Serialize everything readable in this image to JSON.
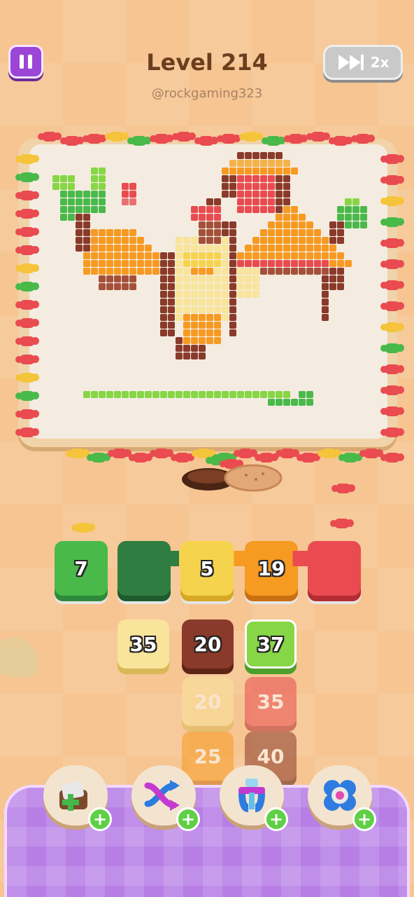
{
  "header": {
    "title": "Level 214",
    "handle": "@rockgaming323",
    "speed_label": "2x"
  },
  "colors": {
    "red": "#e94b50",
    "green": "#49b94a",
    "dark_green": "#2f7d40",
    "yellow": "#f5d34c",
    "orange": "#f79a22",
    "brown": "#8a3a2a",
    "cream": "#f8e49a",
    "lime": "#86d645"
  },
  "slots": [
    {
      "label": "7",
      "color": "green"
    },
    {
      "label": "",
      "color": "dark_green"
    },
    {
      "label": "5",
      "color": "yellow"
    },
    {
      "label": "19",
      "color": "orange"
    },
    {
      "label": "",
      "color": "red"
    }
  ],
  "tiles": [
    {
      "label": "35",
      "color": "cream",
      "state": "active"
    },
    {
      "label": "20",
      "color": "brown",
      "state": "active"
    },
    {
      "label": "37",
      "color": "lime",
      "state": "selected"
    },
    {
      "label": "20",
      "color": "cream",
      "state": "dim"
    },
    {
      "label": "35",
      "color": "red",
      "state": "dim"
    },
    {
      "label": "25",
      "color": "orange",
      "state": "dim"
    },
    {
      "label": "40",
      "color": "brown",
      "state": "dim"
    }
  ],
  "powerups": [
    {
      "icon": "add-box-icon",
      "badge": "+"
    },
    {
      "icon": "shuffle-arrows-icon",
      "badge": "+"
    },
    {
      "icon": "magnet-claw-icon",
      "badge": "+"
    },
    {
      "icon": "flower-gear-icon",
      "badge": "+"
    }
  ]
}
